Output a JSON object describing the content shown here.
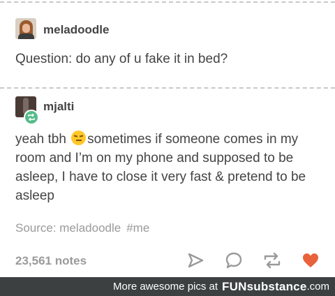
{
  "post": {
    "author": "meladoodle",
    "text": "Question: do any of u fake it in bed?"
  },
  "reblog": {
    "author": "mjalti",
    "text_before_emoji": "yeah tbh ",
    "emoji": "unamused-face-emoji",
    "text_after_emoji": "sometimes if someone comes in my room and I’m on my phone and supposed to be asleep, I have to close it very fast & pretend to be asleep"
  },
  "source": {
    "label": "Source: meladoodle",
    "tag": "#me"
  },
  "footer_actions": {
    "notes": "23,561 notes",
    "icons": [
      "share-icon",
      "reply-icon",
      "reblog-icon",
      "heart-icon"
    ],
    "heart_color": "#e8633c",
    "icon_color": "#9a9a9a"
  },
  "watermark": {
    "prefix": "More awesome pics at",
    "brand": "FUNsubstance",
    "suffix": ".com"
  },
  "colors": {
    "reblog_badge": "#56bc8a",
    "footer_bg": "#3c4041"
  }
}
